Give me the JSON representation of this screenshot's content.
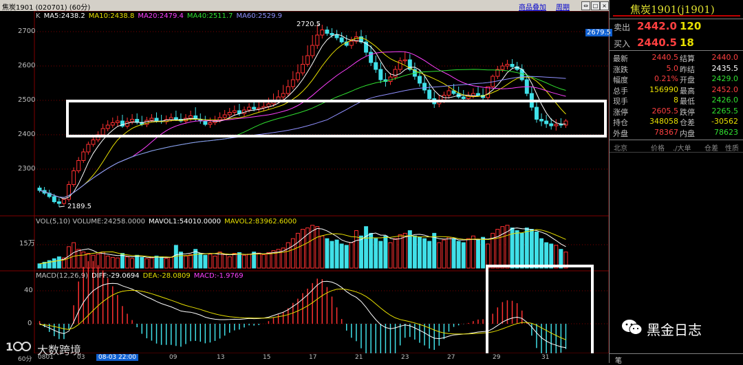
{
  "window": {
    "title": "焦炭1901 (020701) (60分)",
    "overlay_link": "商品叠加",
    "period_link": "周期"
  },
  "ma_legend": [
    {
      "text": "K",
      "color": "#c0c0c0"
    },
    {
      "text": "MA5:2438.2",
      "color": "#ffffff"
    },
    {
      "text": "MA10:2438.8",
      "color": "#e8e000"
    },
    {
      "text": "MA20:2479.4",
      "color": "#ff40ff"
    },
    {
      "text": "MA40:2511.7",
      "color": "#30e030"
    },
    {
      "text": "MA60:2529.9",
      "color": "#9090ff"
    }
  ],
  "price_axis": {
    "ticks": [
      "2700",
      "2600",
      "2500",
      "2400",
      "2300"
    ],
    "current_price_label": "2679.5"
  },
  "price_annotations": {
    "high": "2720.5",
    "low": "2189.5"
  },
  "vol_legend": [
    {
      "text": "VOL(5,10) VOLUME:24258.0000",
      "color": "#c0c0c0"
    },
    {
      "text": "MAVOL1:54010.0000",
      "color": "#ffffff"
    },
    {
      "text": "MAVOL2:83962.6000",
      "color": "#e8e000"
    }
  ],
  "vol_axis": {
    "tick": "15万"
  },
  "macd_legend": [
    {
      "text": "MACD(12,26,9)",
      "color": "#c0c0c0"
    },
    {
      "text": "DIFF:-29.0694",
      "color": "#ffffff"
    },
    {
      "text": "DEA:-28.0809",
      "color": "#e8e000"
    },
    {
      "text": "MACD:-1.9769",
      "color": "#ff40ff"
    }
  ],
  "macd_axis": {
    "ticks": [
      "40",
      "0"
    ]
  },
  "time_axis": {
    "period": "60分",
    "labels": [
      "0801",
      "03",
      "09",
      "13",
      "15",
      "17",
      "21",
      "23",
      "27",
      "29",
      "31"
    ],
    "cursor_label": "08-03 22:00"
  },
  "quote": {
    "title": "焦炭1901(j1901)",
    "ask_label": "卖出",
    "ask_price": "2442.0",
    "ask_vol": "120",
    "bid_label": "买入",
    "bid_price": "2440.5",
    "bid_vol": "18",
    "rows": [
      {
        "l1": "最新",
        "v1": "2440.5",
        "c1": "#ff4040",
        "l2": "结算",
        "v2": "2440.0",
        "c2": "#ff4040"
      },
      {
        "l1": "涨跌",
        "v1": "5.0",
        "c1": "#ff4040",
        "l2": "昨结",
        "v2": "2435.5",
        "c2": "#ffffff"
      },
      {
        "l1": "幅度",
        "v1": "0.21%",
        "c1": "#ff4040",
        "l2": "开盘",
        "v2": "2429.0",
        "c2": "#30e030"
      },
      {
        "l1": "总手",
        "v1": "156990",
        "c1": "#e8e000",
        "l2": "最高",
        "v2": "2452.0",
        "c2": "#ff4040"
      },
      {
        "l1": "现手",
        "v1": "8",
        "c1": "#e8e000",
        "l2": "最低",
        "v2": "2426.0",
        "c2": "#30e030"
      },
      {
        "l1": "涨停",
        "v1": "2605.5",
        "c1": "#ff4040",
        "l2": "跌停",
        "v2": "2265.5",
        "c2": "#30e030"
      },
      {
        "l1": "持仓",
        "v1": "348058",
        "c1": "#e8e000",
        "l2": "仓差",
        "v2": "-30562",
        "c2": "#e8e000"
      },
      {
        "l1": "外盘",
        "v1": "78367",
        "c1": "#ff4040",
        "l2": "内盘",
        "v2": "78623",
        "c2": "#30e030"
      }
    ],
    "trade_headers": [
      "北京",
      "价格",
      "./大单",
      "仓差",
      "性质"
    ],
    "bottom_tab": "笔"
  },
  "watermark": {
    "brand": "黑金日志",
    "logo_text": "大数跨境"
  },
  "colors": {
    "up": "#ff3030",
    "down": "#40e0e8",
    "bg": "#000000",
    "grid": "#800000"
  },
  "chart_data": {
    "type": "candlestick",
    "title": "焦炭1901 60分",
    "ylim": [
      2180,
      2730
    ],
    "price": {
      "open": [
        2245,
        2238,
        2230,
        2220,
        2205,
        2200,
        2212,
        2255,
        2295,
        2325,
        2350,
        2372,
        2385,
        2400,
        2418,
        2428,
        2435,
        2440,
        2425,
        2438,
        2445,
        2436,
        2430,
        2442,
        2448,
        2440,
        2438,
        2444,
        2450,
        2445,
        2440,
        2448,
        2455,
        2445,
        2440,
        2430,
        2435,
        2442,
        2450,
        2458,
        2465,
        2470,
        2462,
        2472,
        2480,
        2475,
        2478,
        2482,
        2490,
        2500,
        2510,
        2520,
        2540,
        2560,
        2580,
        2605,
        2630,
        2660,
        2690,
        2705,
        2695,
        2690,
        2682,
        2670,
        2660,
        2672,
        2685,
        2670,
        2640,
        2610,
        2590,
        2560,
        2555,
        2568,
        2590,
        2615,
        2618,
        2590,
        2570,
        2550,
        2530,
        2505,
        2490,
        2500,
        2515,
        2528,
        2520,
        2510,
        2505,
        2512,
        2520,
        2515,
        2508,
        2540,
        2570,
        2590,
        2600,
        2605,
        2598,
        2590,
        2560,
        2520,
        2480,
        2445,
        2440,
        2432,
        2426,
        2430,
        2428
      ],
      "high": [
        2252,
        2248,
        2240,
        2228,
        2215,
        2215,
        2265,
        2305,
        2335,
        2360,
        2380,
        2395,
        2410,
        2432,
        2442,
        2450,
        2455,
        2458,
        2450,
        2460,
        2462,
        2455,
        2452,
        2460,
        2465,
        2458,
        2456,
        2462,
        2470,
        2462,
        2460,
        2470,
        2480,
        2462,
        2455,
        2450,
        2455,
        2465,
        2472,
        2478,
        2485,
        2490,
        2482,
        2492,
        2500,
        2495,
        2500,
        2508,
        2520,
        2530,
        2545,
        2560,
        2585,
        2605,
        2630,
        2660,
        2690,
        2720,
        2720,
        2715,
        2710,
        2705,
        2698,
        2690,
        2685,
        2700,
        2705,
        2690,
        2660,
        2630,
        2610,
        2580,
        2580,
        2600,
        2625,
        2640,
        2635,
        2610,
        2590,
        2570,
        2550,
        2525,
        2515,
        2525,
        2540,
        2548,
        2540,
        2530,
        2525,
        2535,
        2540,
        2535,
        2530,
        2575,
        2600,
        2610,
        2618,
        2620,
        2612,
        2605,
        2575,
        2540,
        2500,
        2462,
        2458,
        2448,
        2445,
        2448,
        2446
      ],
      "low": [
        2232,
        2225,
        2215,
        2200,
        2190,
        2195,
        2205,
        2248,
        2288,
        2318,
        2342,
        2365,
        2378,
        2392,
        2410,
        2420,
        2425,
        2420,
        2418,
        2430,
        2430,
        2425,
        2422,
        2436,
        2435,
        2432,
        2430,
        2438,
        2440,
        2435,
        2432,
        2440,
        2440,
        2432,
        2425,
        2420,
        2428,
        2435,
        2442,
        2450,
        2455,
        2455,
        2452,
        2465,
        2468,
        2465,
        2470,
        2475,
        2482,
        2492,
        2502,
        2512,
        2532,
        2552,
        2572,
        2598,
        2622,
        2650,
        2680,
        2688,
        2682,
        2675,
        2665,
        2655,
        2650,
        2665,
        2665,
        2630,
        2600,
        2580,
        2550,
        2540,
        2545,
        2560,
        2582,
        2605,
        2585,
        2560,
        2540,
        2520,
        2495,
        2478,
        2480,
        2492,
        2505,
        2515,
        2505,
        2498,
        2495,
        2505,
        2510,
        2502,
        2500,
        2535,
        2562,
        2582,
        2590,
        2592,
        2585,
        2555,
        2512,
        2470,
        2435,
        2425,
        2420,
        2415,
        2412,
        2420,
        2420
      ],
      "close": [
        2238,
        2230,
        2220,
        2205,
        2200,
        2212,
        2255,
        2295,
        2325,
        2350,
        2372,
        2385,
        2400,
        2418,
        2428,
        2435,
        2440,
        2425,
        2438,
        2445,
        2436,
        2430,
        2442,
        2448,
        2440,
        2438,
        2444,
        2450,
        2445,
        2440,
        2448,
        2455,
        2445,
        2440,
        2430,
        2435,
        2442,
        2450,
        2458,
        2465,
        2470,
        2462,
        2472,
        2480,
        2475,
        2478,
        2482,
        2490,
        2500,
        2510,
        2520,
        2540,
        2560,
        2580,
        2605,
        2630,
        2660,
        2690,
        2705,
        2695,
        2690,
        2682,
        2670,
        2660,
        2672,
        2685,
        2670,
        2640,
        2610,
        2590,
        2560,
        2555,
        2568,
        2590,
        2615,
        2618,
        2590,
        2570,
        2550,
        2530,
        2505,
        2490,
        2500,
        2515,
        2528,
        2520,
        2510,
        2505,
        2512,
        2520,
        2515,
        2508,
        2540,
        2570,
        2590,
        2600,
        2605,
        2598,
        2590,
        2560,
        2520,
        2480,
        2445,
        2440,
        2432,
        2426,
        2430,
        2428,
        2440
      ]
    },
    "volume": [
      16000,
      22000,
      28000,
      35000,
      42000,
      38000,
      80000,
      95000,
      70000,
      60000,
      55000,
      48000,
      52000,
      60000,
      45000,
      40000,
      38000,
      55000,
      42000,
      36000,
      48000,
      40000,
      35000,
      38000,
      45000,
      42000,
      36000,
      40000,
      85000,
      60000,
      45000,
      50000,
      70000,
      55000,
      48000,
      52000,
      45000,
      60000,
      50000,
      42000,
      55000,
      58000,
      48000,
      52000,
      60000,
      56000,
      50000,
      58000,
      65000,
      70000,
      75000,
      95000,
      110000,
      130000,
      145000,
      150000,
      160000,
      155000,
      120000,
      110000,
      100000,
      105000,
      90000,
      85000,
      95000,
      140000,
      120000,
      155000,
      130000,
      110000,
      100000,
      120000,
      95000,
      110000,
      125000,
      130000,
      140000,
      120000,
      115000,
      110000,
      100000,
      130000,
      95000,
      105000,
      115000,
      110000,
      100000,
      95000,
      110000,
      120000,
      105000,
      115000,
      90000,
      130000,
      145000,
      155000,
      160000,
      150000,
      140000,
      130000,
      150000,
      145000,
      135000,
      110000,
      95000,
      90000,
      85000,
      70000,
      60000
    ],
    "macd": {
      "diff": [
        0.0,
        -2.6,
        -5.2,
        -8.0,
        -10.5,
        -12.0,
        -9.0,
        2.0,
        15.0,
        26.0,
        34.0,
        40.0,
        44.0,
        47.0,
        48.5,
        49.0,
        48.5,
        46.0,
        44.0,
        42.0,
        39.0,
        35.5,
        32.5,
        30.0,
        27.0,
        24.5,
        22.5,
        20.5,
        18.0,
        15.5,
        14.5,
        14.0,
        12.5,
        10.5,
        8.0,
        6.5,
        5.5,
        5.0,
        5.0,
        5.2,
        5.5,
        5.3,
        5.8,
        6.5,
        6.2,
        6.3,
        6.8,
        8.0,
        10.0,
        12.0,
        14.0,
        17.0,
        21.0,
        25.0,
        30.0,
        35.0,
        41.0,
        47.0,
        51.0,
        51.5,
        50.5,
        48.0,
        44.0,
        39.0,
        35.0,
        32.0,
        27.0,
        20.0,
        12.0,
        5.0,
        -1.0,
        -4.5,
        -6.0,
        -5.0,
        -3.0,
        -1.5,
        -2.5,
        -5.0,
        -8.0,
        -11.0,
        -14.5,
        -17.5,
        -18.0,
        -17.0,
        -15.0,
        -13.5,
        -13.0,
        -12.5,
        -12.0,
        -11.0,
        -10.0,
        -9.5,
        -9.0,
        -6.0,
        -2.0,
        2.0,
        5.0,
        7.0,
        8.0,
        6.5,
        2.0,
        -4.0,
        -11.0,
        -17.0,
        -21.0,
        -24.0,
        -26.0,
        -28.0,
        -29.0
      ],
      "dea": [
        -1.0,
        -1.3,
        -2.1,
        -3.3,
        -4.7,
        -6.2,
        -6.8,
        -5.0,
        -1.0,
        4.4,
        10.3,
        16.2,
        21.8,
        26.8,
        31.2,
        34.8,
        37.6,
        39.3,
        40.2,
        40.6,
        40.3,
        39.3,
        38.0,
        36.4,
        34.5,
        32.5,
        30.5,
        28.5,
        26.4,
        24.2,
        22.2,
        20.6,
        19.0,
        17.3,
        15.4,
        13.6,
        12.0,
        10.6,
        9.5,
        8.6,
        8.0,
        7.5,
        7.2,
        7.1,
        6.9,
        6.8,
        6.8,
        7.0,
        7.6,
        8.5,
        9.6,
        11.1,
        13.1,
        15.5,
        18.4,
        21.7,
        25.6,
        29.9,
        34.1,
        37.6,
        40.2,
        41.8,
        42.2,
        41.6,
        40.3,
        38.6,
        36.3,
        33.1,
        28.9,
        24.1,
        19.1,
        14.4,
        10.3,
        7.2,
        5.2,
        3.8,
        2.5,
        1.0,
        -0.8,
        -2.8,
        -5.1,
        -7.6,
        -9.7,
        -11.2,
        -12.0,
        -12.3,
        -12.4,
        -12.4,
        -12.3,
        -12.0,
        -11.6,
        -11.2,
        -10.8,
        -9.8,
        -8.2,
        -6.2,
        -3.9,
        -1.7,
        0.2,
        1.5,
        1.6,
        0.5,
        -1.8,
        -4.9,
        -8.1,
        -11.3,
        -14.2,
        -17.0,
        -19.4
      ]
    }
  }
}
